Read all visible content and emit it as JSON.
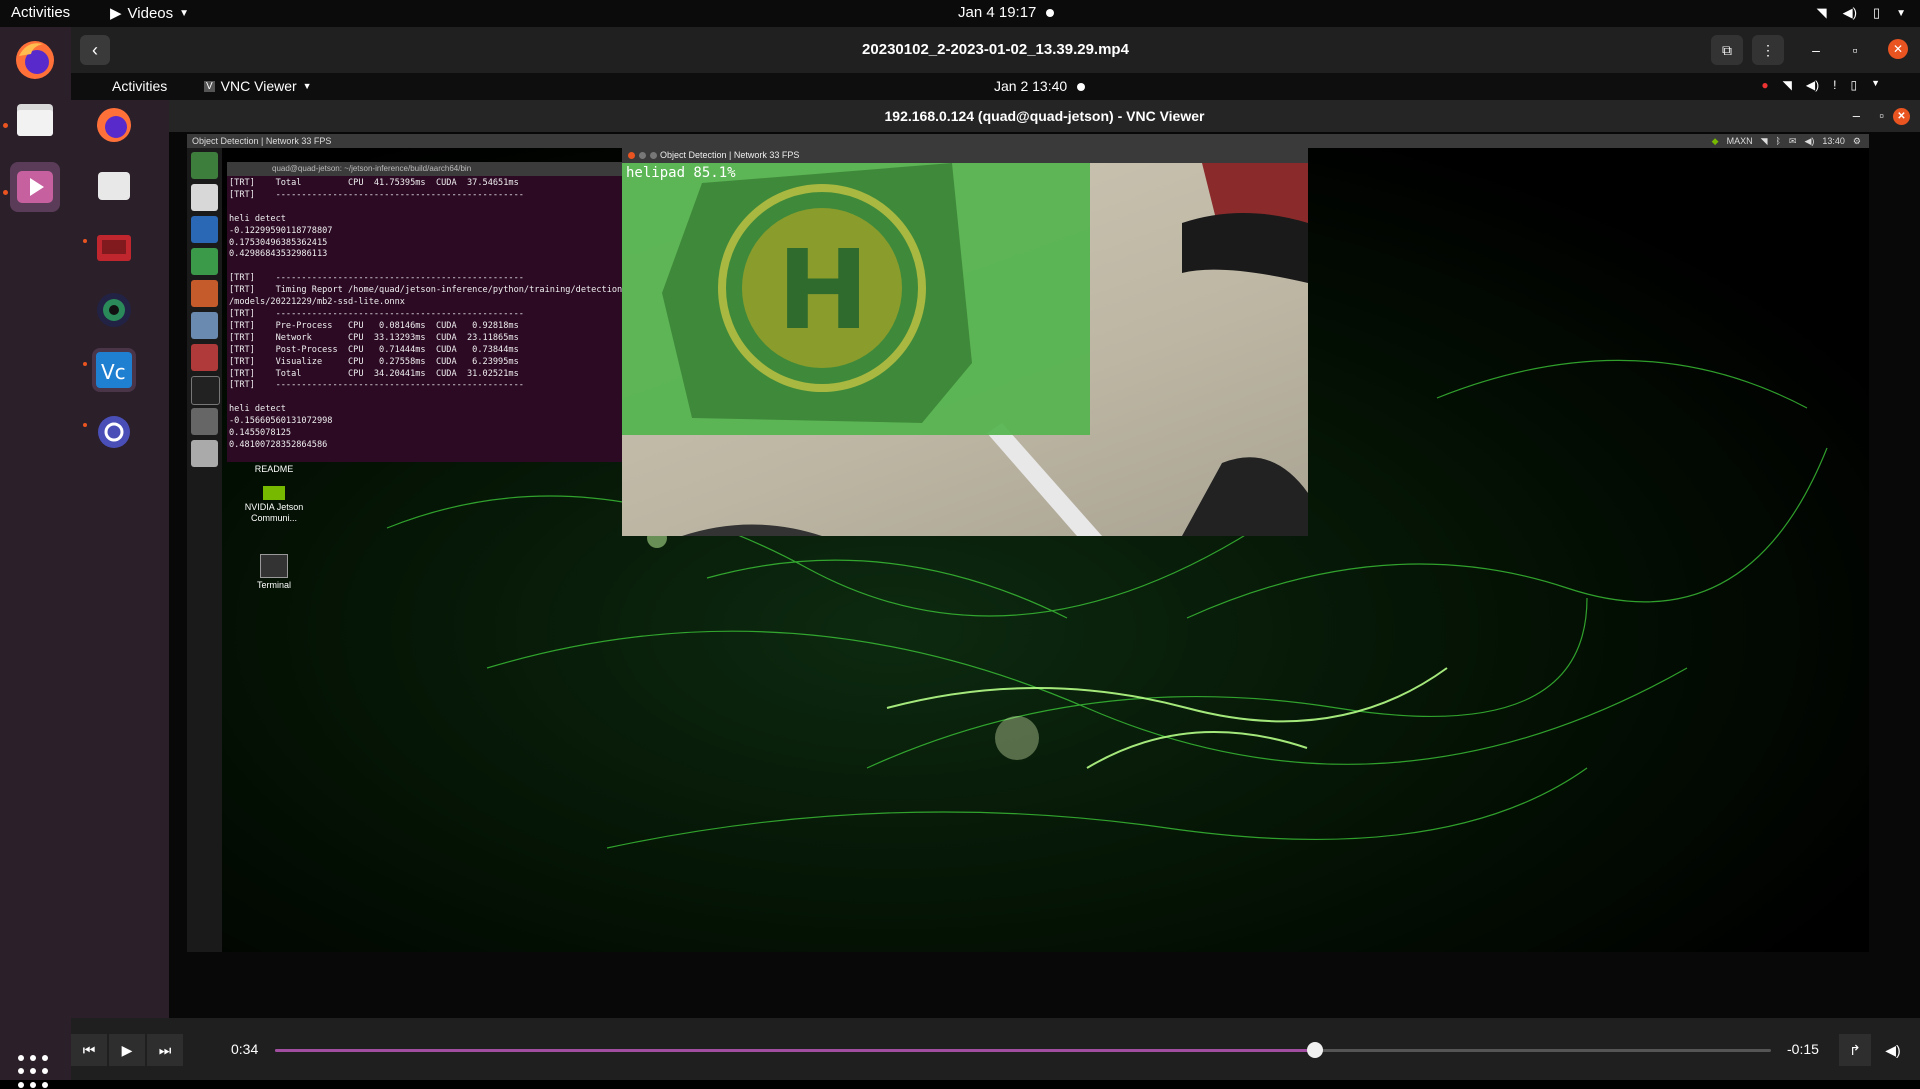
{
  "topbar": {
    "activities": "Activities",
    "app": "Videos",
    "clock": "Jan 4  19:17"
  },
  "player": {
    "title": "20230102_2-2023-01-02_13.39.29.mp4",
    "elapsed": "0:34",
    "remaining": "-0:15",
    "progress": 0.695
  },
  "remote_topbar": {
    "activities": "Activities",
    "app": "VNC Viewer",
    "clock": "Jan 2  13:40"
  },
  "vnc": {
    "title": "192.168.0.124 (quad@quad-jetson) - VNC Viewer"
  },
  "remote": {
    "panel_title": "Object Detection | Network 33 FPS",
    "tray_mode": "MAXN",
    "tray_clock": "13:40",
    "terminal_title": "quad@quad-jetson: ~/jetson-inference/build/aarch64/bin",
    "terminal_lines": [
      "[TRT]    Total         CPU  41.75395ms  CUDA  37.54651ms",
      "[TRT]    ------------------------------------------------",
      "",
      "heli detect",
      "-0.12299590118778807",
      "0.17530496385362415",
      "0.42986843532986113",
      "",
      "[TRT]    ------------------------------------------------",
      "[TRT]    Timing Report /home/quad/jetson-inference/python/training/detection/ssd",
      "/models/20221229/mb2-ssd-lite.onnx",
      "[TRT]    ------------------------------------------------",
      "[TRT]    Pre-Process   CPU   0.08146ms  CUDA   0.92818ms",
      "[TRT]    Network       CPU  33.13293ms  CUDA  23.11865ms",
      "[TRT]    Post-Process  CPU   0.71444ms  CUDA   0.73844ms",
      "[TRT]    Visualize     CPU   0.27558ms  CUDA   6.23995ms",
      "[TRT]    Total         CPU  34.20441ms  CUDA  31.02521ms",
      "[TRT]    ------------------------------------------------",
      "",
      "heli detect",
      "-0.15660560131072998",
      "0.1455078125",
      "0.48100728352864586"
    ],
    "detection_window_title": "Object Detection | Network 33 FPS",
    "detection_label": "helipad 85.1%",
    "desktop_icons": [
      "README",
      "NVIDIA Jetson Communi...",
      "Terminal"
    ]
  },
  "colors": {
    "accent": "#e95420",
    "bbox": "#54b44e",
    "progress": "#a24ea0",
    "dock": "#2b1f2a",
    "terminal": "#2c0a24"
  }
}
